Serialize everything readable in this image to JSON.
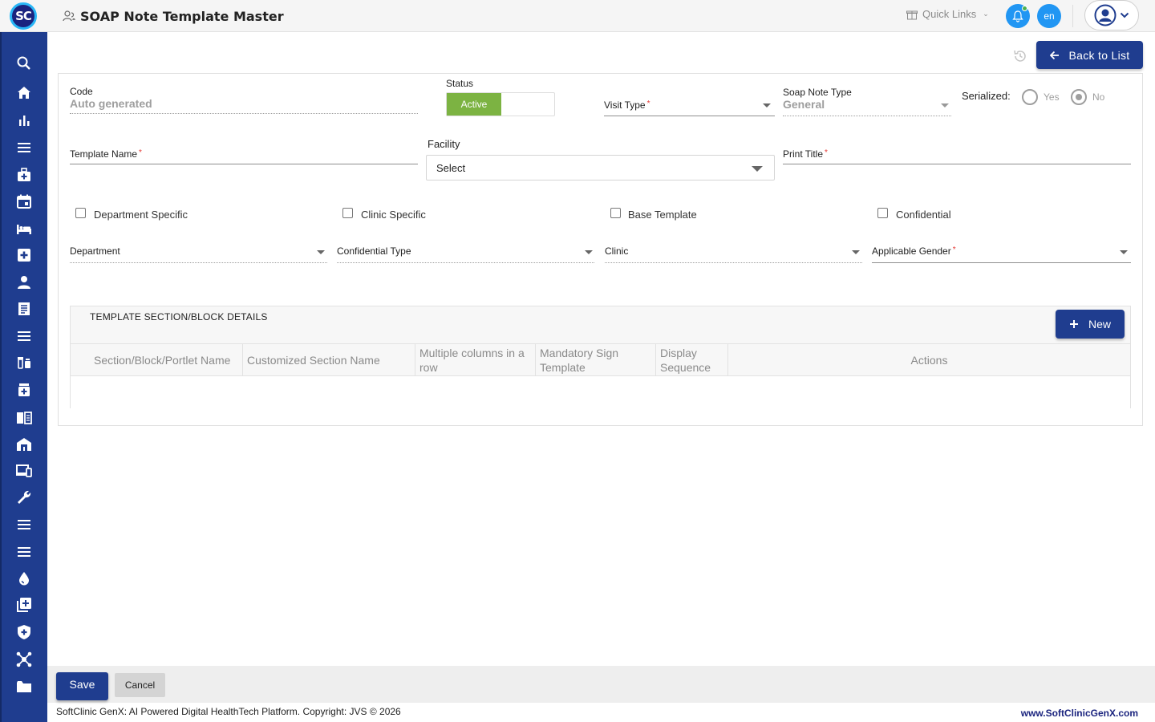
{
  "header": {
    "logo_text": "SC",
    "title": "SOAP Note Template Master",
    "quick_links": "Quick Links",
    "language": "en"
  },
  "sidebar": {
    "icons": [
      "search-icon",
      "home-icon",
      "bar-chart-icon",
      "menu-icon",
      "medical-bag-icon",
      "calendar-icon",
      "bed-icon",
      "first-aid-icon",
      "person-icon",
      "document-list-icon",
      "menu-icon",
      "medication-icon",
      "pharmacy-icon",
      "book-icon",
      "building-icon",
      "devices-icon",
      "wrench-icon",
      "menu-icon",
      "menu-icon",
      "drop-icon",
      "add-box-icon",
      "shield-icon",
      "network-icon",
      "folder-icon"
    ]
  },
  "toolbar": {
    "back_label": "Back to List"
  },
  "form": {
    "code_label": "Code",
    "code_value": "Auto generated",
    "status_label": "Status",
    "status_value": "Active",
    "visit_type_label": "Visit Type",
    "soap_note_type_label": "Soap Note Type",
    "soap_note_type_value": "General",
    "serialized_label": "Serialized:",
    "serialized_yes": "Yes",
    "serialized_no": "No",
    "template_name_label": "Template Name",
    "facility_label": "Facility",
    "facility_value": "Select",
    "print_title_label": "Print Title",
    "required_mark": "*",
    "checkboxes": [
      "Department Specific",
      "Clinic Specific",
      "Base Template",
      "Confidential"
    ],
    "department_label": "Department",
    "confidential_type_label": "Confidential Type",
    "clinic_label": "Clinic",
    "applicable_gender_label": "Applicable Gender"
  },
  "section": {
    "title": "TEMPLATE SECTION/BLOCK DETAILS",
    "new_label": "New",
    "columns": [
      "Section/Block/Portlet Name",
      "Customized Section Name",
      "Multiple columns in a row",
      "Mandatory Sign Template",
      "Display Sequence",
      "Actions"
    ]
  },
  "footer": {
    "save_label": "Save",
    "cancel_label": "Cancel",
    "copyright": "SoftClinic GenX: AI Powered Digital HealthTech Platform. Copyright: JVS © 2026",
    "website": "www.SoftClinicGenX.com"
  },
  "colors": {
    "primary": "#1f3d8f",
    "active_green": "#7cb342",
    "accent_blue": "#2196f3"
  }
}
